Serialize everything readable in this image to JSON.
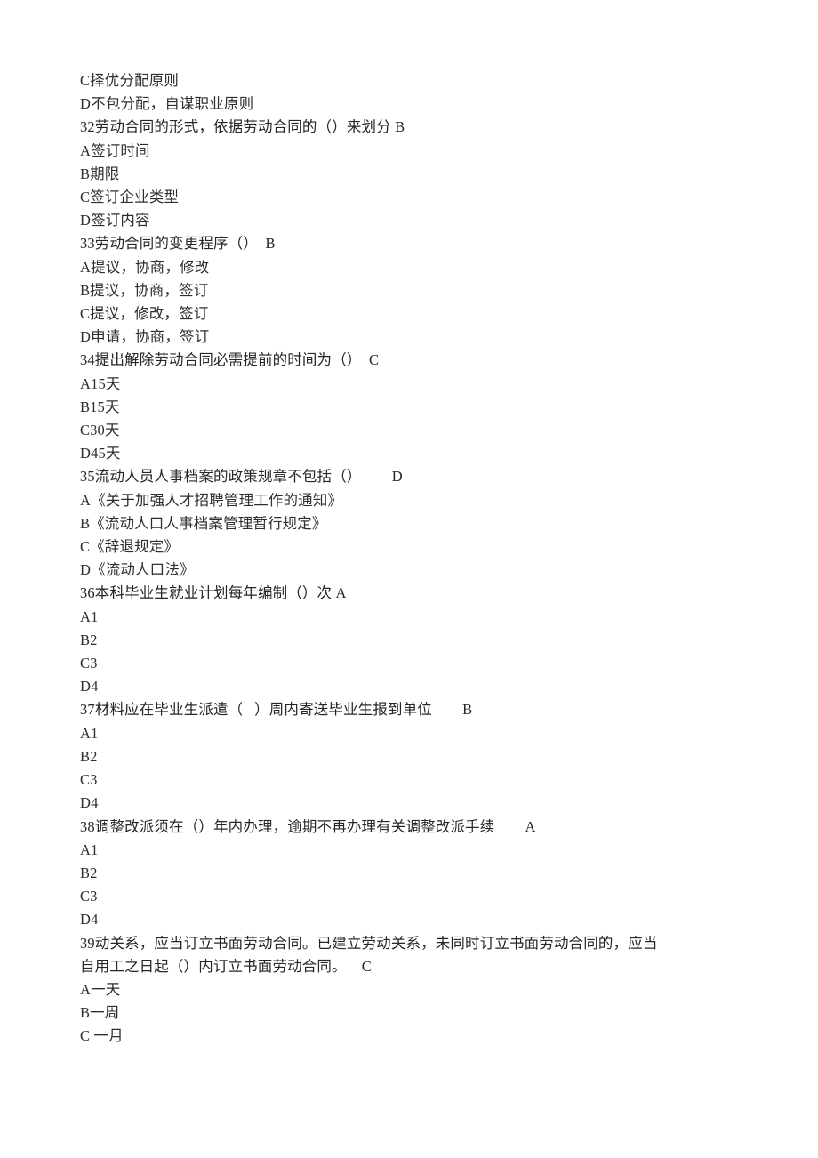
{
  "document": {
    "page_background": "#ffffff",
    "text_color": "#2b2b2b",
    "lines": [
      {
        "id": "l01",
        "kind": "option",
        "text": "C择优分配原则"
      },
      {
        "id": "l02",
        "kind": "option",
        "text": "D不包分配，自谋职业原则"
      },
      {
        "id": "l03",
        "kind": "stem",
        "text": "32劳动合同的形式，依据劳动合同的（）来划分 B"
      },
      {
        "id": "l04",
        "kind": "option",
        "text": "A签订时间"
      },
      {
        "id": "l05",
        "kind": "option",
        "text": "B期限"
      },
      {
        "id": "l06",
        "kind": "option",
        "text": "C签订企业类型"
      },
      {
        "id": "l07",
        "kind": "option",
        "text": "D签订内容"
      },
      {
        "id": "l08",
        "kind": "stem",
        "text": "33劳动合同的变更程序（）  B"
      },
      {
        "id": "l09",
        "kind": "option",
        "text": "A提议，协商，修改"
      },
      {
        "id": "l10",
        "kind": "option",
        "text": "B提议，协商，签订"
      },
      {
        "id": "l11",
        "kind": "option",
        "text": "C提议，修改，签订"
      },
      {
        "id": "l12",
        "kind": "option",
        "text": "D申请，协商，签订"
      },
      {
        "id": "l13",
        "kind": "stem",
        "text": "34提出解除劳动合同必需提前的时间为（）  C"
      },
      {
        "id": "l14",
        "kind": "option",
        "text": "A15天"
      },
      {
        "id": "l15",
        "kind": "option",
        "text": "B15天"
      },
      {
        "id": "l16",
        "kind": "option",
        "text": "C30天"
      },
      {
        "id": "l17",
        "kind": "option",
        "text": "D45天"
      },
      {
        "id": "l18",
        "kind": "stem",
        "text": "35流动人员人事档案的政策规章不包括（）        D"
      },
      {
        "id": "l19",
        "kind": "option",
        "text": "A《关于加强人才招聘管理工作的通知》"
      },
      {
        "id": "l20",
        "kind": "option",
        "text": "B《流动人口人事档案管理暂行规定》"
      },
      {
        "id": "l21",
        "kind": "option",
        "text": "C《辞退规定》"
      },
      {
        "id": "l22",
        "kind": "option",
        "text": "D《流动人口法》"
      },
      {
        "id": "l23",
        "kind": "stem",
        "text": "36本科毕业生就业计划每年编制（）次 A"
      },
      {
        "id": "l24",
        "kind": "option",
        "text": "A1"
      },
      {
        "id": "l25",
        "kind": "option",
        "text": "B2"
      },
      {
        "id": "l26",
        "kind": "option",
        "text": "C3"
      },
      {
        "id": "l27",
        "kind": "option",
        "text": "D4"
      },
      {
        "id": "l28",
        "kind": "stem",
        "text": "37材料应在毕业生派遣（   ）周内寄送毕业生报到单位        B"
      },
      {
        "id": "l29",
        "kind": "option",
        "text": "A1"
      },
      {
        "id": "l30",
        "kind": "option",
        "text": "B2"
      },
      {
        "id": "l31",
        "kind": "option",
        "text": "C3"
      },
      {
        "id": "l32",
        "kind": "option",
        "text": "D4"
      },
      {
        "id": "l33",
        "kind": "stem",
        "text": "38调整改派须在（）年内办理，逾期不再办理有关调整改派手续        A"
      },
      {
        "id": "l34",
        "kind": "option",
        "text": "A1"
      },
      {
        "id": "l35",
        "kind": "option",
        "text": "B2"
      },
      {
        "id": "l36",
        "kind": "option",
        "text": "C3"
      },
      {
        "id": "l37",
        "kind": "option",
        "text": "D4"
      },
      {
        "id": "l38",
        "kind": "stem",
        "text": "39动关系，应当订立书面劳动合同。已建立劳动关系，未同时订立书面劳动合同的，应当"
      },
      {
        "id": "l39",
        "kind": "wrap",
        "text": "自用工之日起（）内订立书面劳动合同。    C"
      },
      {
        "id": "l40",
        "kind": "option",
        "text": "A一天"
      },
      {
        "id": "l41",
        "kind": "option",
        "text": "B一周"
      },
      {
        "id": "l42",
        "kind": "option",
        "text": "C 一月"
      }
    ]
  }
}
